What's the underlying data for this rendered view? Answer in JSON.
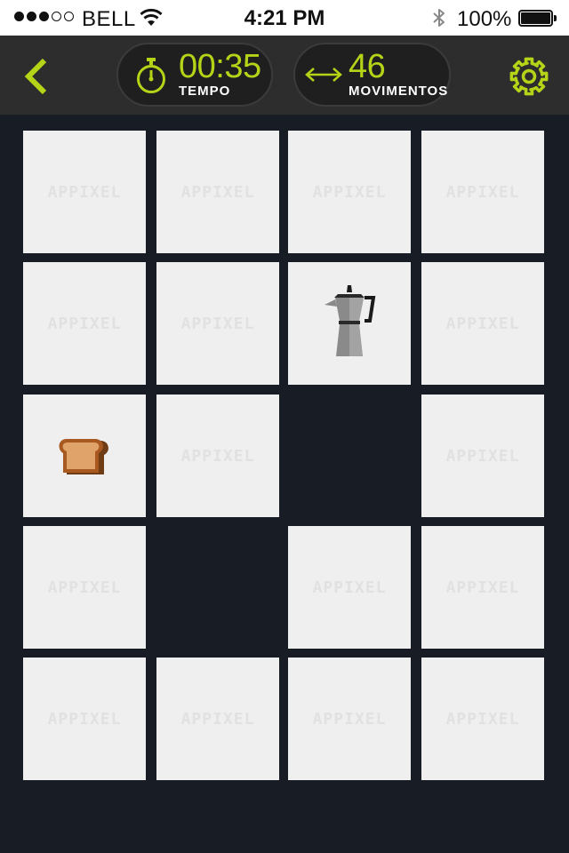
{
  "status_bar": {
    "carrier": "BELL",
    "signal_bars_filled": 3,
    "signal_bars_total": 5,
    "time": "4:21 PM",
    "battery_percent": "100%",
    "battery_level": 1.0,
    "icons": [
      "wifi-icon",
      "bluetooth-icon",
      "battery-icon"
    ]
  },
  "header": {
    "back_icon": "chevron-left-icon",
    "timer": {
      "icon": "stopwatch-icon",
      "value": "00:35",
      "label": "TEMPO"
    },
    "moves": {
      "icon": "horizontal-arrows-icon",
      "value": "46",
      "label": "MOVIMENTOS"
    },
    "settings_icon": "gear-icon"
  },
  "board": {
    "rows": 5,
    "cols": 4,
    "card_back_text": "APPIXEL",
    "cards": [
      {
        "state": "hidden"
      },
      {
        "state": "hidden"
      },
      {
        "state": "hidden"
      },
      {
        "state": "hidden"
      },
      {
        "state": "hidden"
      },
      {
        "state": "hidden"
      },
      {
        "state": "revealed",
        "icon": "moka-pot-icon"
      },
      {
        "state": "hidden"
      },
      {
        "state": "revealed",
        "icon": "toast-icon"
      },
      {
        "state": "hidden"
      },
      {
        "state": "matched"
      },
      {
        "state": "hidden"
      },
      {
        "state": "hidden"
      },
      {
        "state": "matched"
      },
      {
        "state": "hidden"
      },
      {
        "state": "hidden"
      },
      {
        "state": "hidden"
      },
      {
        "state": "hidden"
      },
      {
        "state": "hidden"
      },
      {
        "state": "hidden"
      }
    ]
  },
  "colors": {
    "accent": "#b5d417",
    "background": "#181c24",
    "header": "#2d2d2d",
    "card": "#efefef",
    "card_logo": "#e1e1e1"
  }
}
